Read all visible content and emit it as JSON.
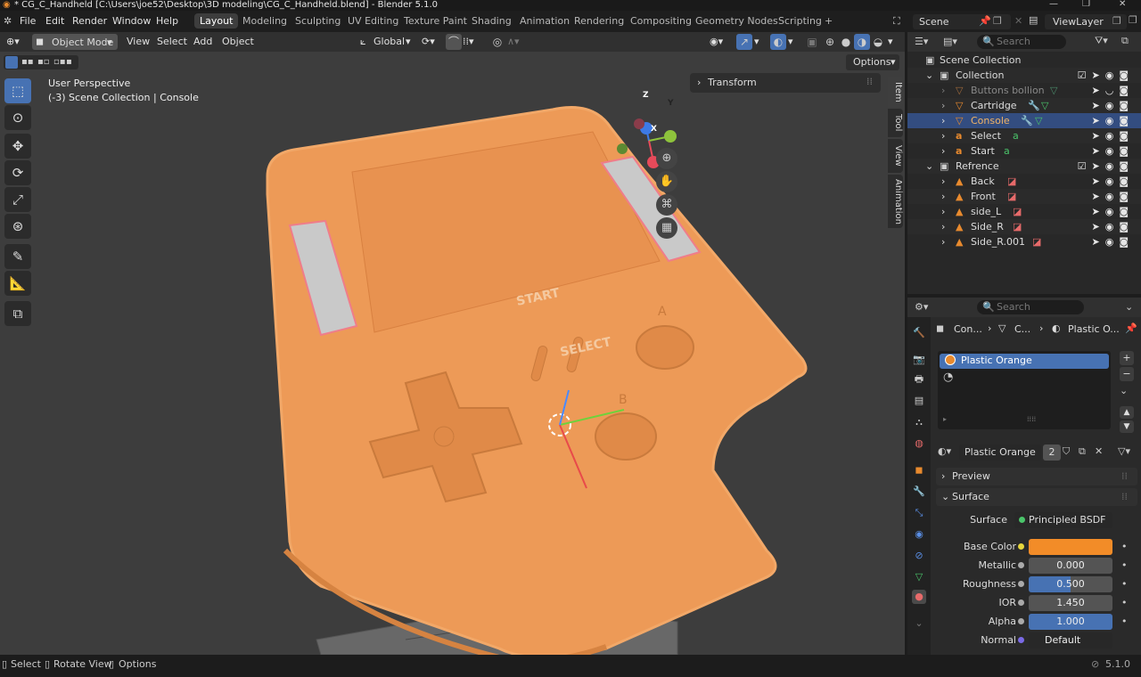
{
  "window": {
    "title": "* CG_C_Handheld [C:\\Users\\joe52\\Desktop\\3D modeling\\CG_C_Handheld.blend] - Blender 5.1.0"
  },
  "menu": {
    "file": "File",
    "edit": "Edit",
    "render": "Render",
    "window": "Window",
    "help": "Help"
  },
  "workspaces": [
    "Layout",
    "Modeling",
    "Sculpting",
    "UV Editing",
    "Texture Paint",
    "Shading",
    "Animation",
    "Rendering",
    "Compositing",
    "Geometry Nodes",
    "Scripting",
    "+"
  ],
  "scene": {
    "name": "Scene",
    "view_layer": "ViewLayer"
  },
  "viewport_header": {
    "mode": "Object Mode",
    "view": "View",
    "select": "Select",
    "add": "Add",
    "object": "Object",
    "orientation": "Global",
    "options": "Options"
  },
  "viewport": {
    "overlay_line1": "User Perspective",
    "overlay_line2": "(-3) Scene Collection | Console",
    "transform_panel": "Transform",
    "npanel_tabs": [
      "Item",
      "Tool",
      "View",
      "Animation"
    ],
    "model_labels": {
      "start": "START",
      "select": "SELECT",
      "a": "A",
      "b": "B"
    },
    "gizmo": {
      "z": "Z",
      "y": "Y",
      "x": "X"
    }
  },
  "outliner": {
    "search_placeholder": "Search",
    "rows": [
      {
        "label": "Scene Collection"
      },
      {
        "label": "Collection"
      },
      {
        "label": "Buttons bollion"
      },
      {
        "label": "Cartridge"
      },
      {
        "label": "Console"
      },
      {
        "label": "Select"
      },
      {
        "label": "Start"
      },
      {
        "label": "Refrence"
      },
      {
        "label": "Back"
      },
      {
        "label": "Front"
      },
      {
        "label": "side_L"
      },
      {
        "label": "Side_R"
      },
      {
        "label": "Side_R.001"
      }
    ]
  },
  "properties": {
    "search_placeholder": "Search",
    "breadcrumb": [
      "Con...",
      "C...",
      "Plastic O..."
    ],
    "material_slot": "Plastic Orange",
    "material_name": "Plastic Orange",
    "material_users": "2",
    "sections": {
      "preview": "Preview",
      "surface": "Surface"
    },
    "surface_shader_label": "Surface",
    "surface_shader": "Principled BSDF",
    "fields": [
      {
        "label": "Base Color",
        "value": ""
      },
      {
        "label": "Metallic",
        "value": "0.000"
      },
      {
        "label": "Roughness",
        "value": "0.500"
      },
      {
        "label": "IOR",
        "value": "1.450"
      },
      {
        "label": "Alpha",
        "value": "1.000"
      },
      {
        "label": "Normal",
        "value": "Default"
      }
    ],
    "base_color": "#f28c28"
  },
  "statusbar": {
    "select": "Select",
    "rotate": "Rotate View",
    "options": "Options",
    "version": "5.1.0"
  }
}
